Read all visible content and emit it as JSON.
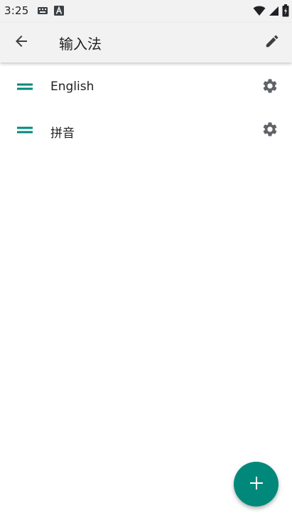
{
  "status_bar": {
    "time": "3:25",
    "left_icons": [
      "keyboard-icon",
      "text-a-icon"
    ],
    "right_icons": [
      "wifi-icon",
      "cell-signal-icon",
      "battery-icon"
    ]
  },
  "app_bar": {
    "title": "输入法",
    "back_icon": "arrow-back-icon",
    "edit_icon": "pencil-icon"
  },
  "input_methods": [
    {
      "label": "English"
    },
    {
      "label": "拼音"
    }
  ],
  "fab": {
    "icon": "plus-icon"
  },
  "colors": {
    "accent": "#00897b",
    "bar_background": "#f2f2f2",
    "icon_gray": "#5f6368"
  }
}
